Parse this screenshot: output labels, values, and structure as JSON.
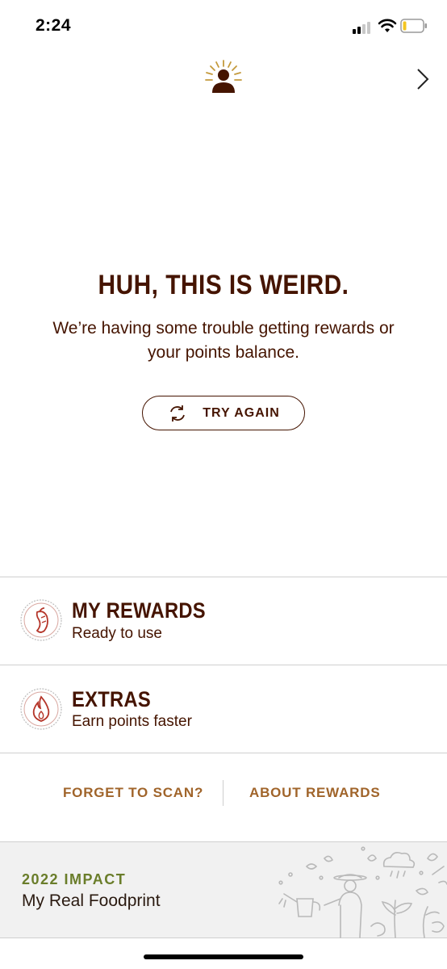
{
  "status_bar": {
    "time": "2:24"
  },
  "header": {
    "profile_icon": "profile-sun-icon",
    "next_icon": "chevron-right-icon"
  },
  "error": {
    "title": "HUH, THIS IS WEIRD.",
    "message_line1": "We’re having some trouble getting rewards or",
    "message_line2": "your points balance.",
    "retry_label": "TRY AGAIN"
  },
  "rows": [
    {
      "title": "MY REWARDS",
      "subtitle": "Ready to use",
      "icon": "pepper-badge-icon"
    },
    {
      "title": "EXTRAS",
      "subtitle": "Earn points faster",
      "icon": "flame-badge-icon"
    }
  ],
  "links": {
    "forget_scan": "FORGET TO SCAN?",
    "about_rewards": "ABOUT REWARDS"
  },
  "impact": {
    "year_label": "2022 IMPACT",
    "title": "My Real Foodprint",
    "art_icon": "farmer-illustration-icon"
  },
  "colors": {
    "brown": "#451400",
    "gold": "#a0642a",
    "olive": "#6a7d2a",
    "footer_bg": "#f1f1f1"
  }
}
